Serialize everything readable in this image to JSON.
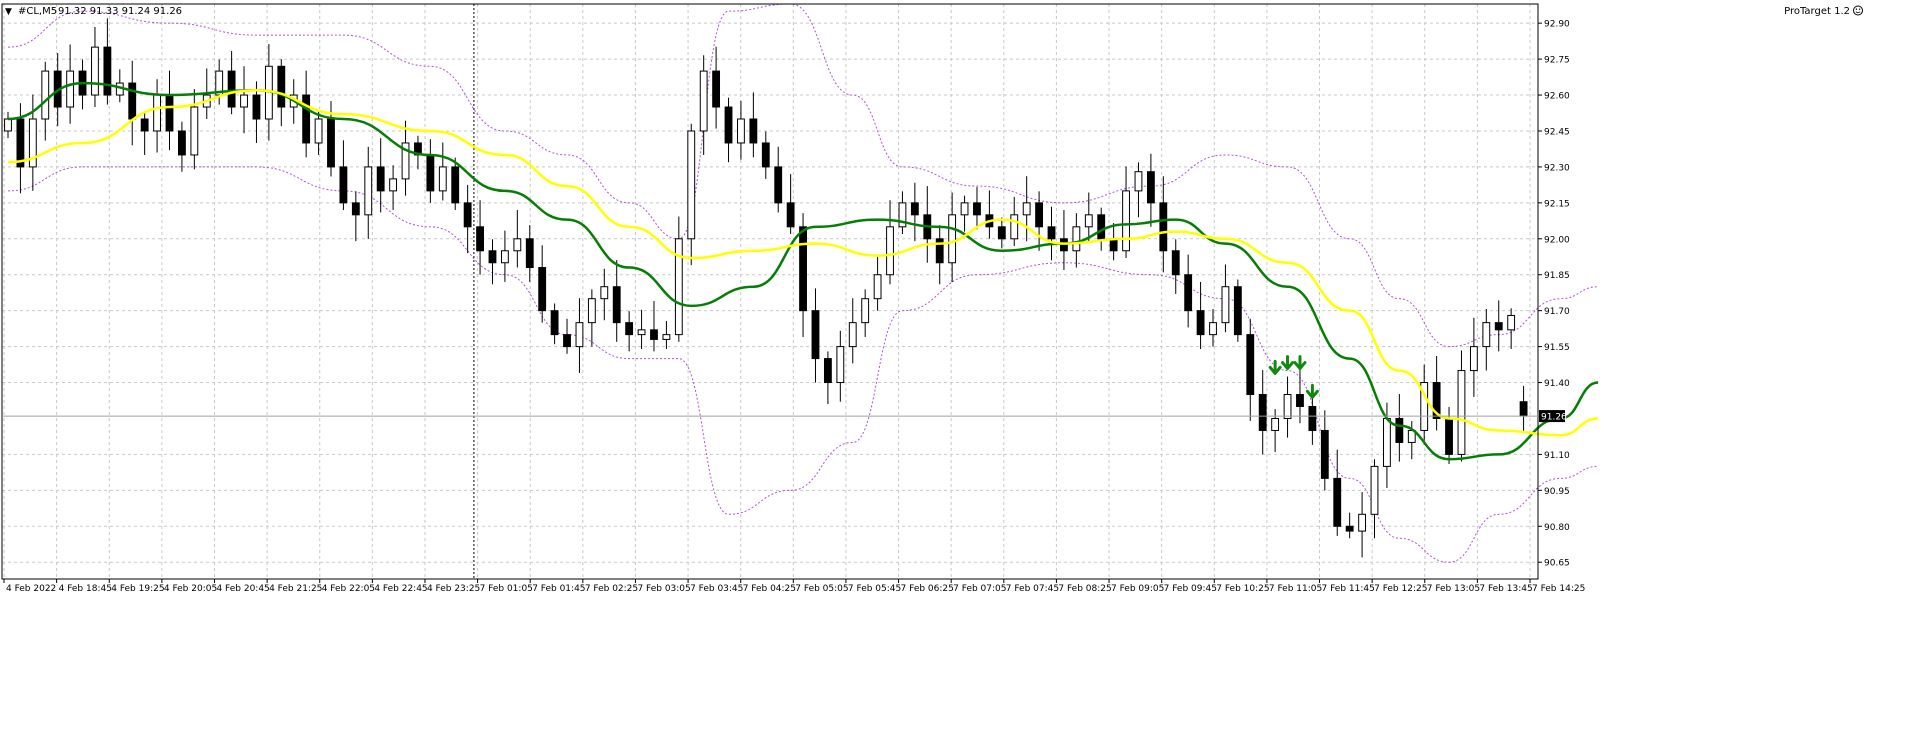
{
  "header": {
    "menu_glyph": "▼",
    "symbol": "#CL,M5",
    "ohlc": "91.32 91.33 91.24 91.26"
  },
  "indicator": {
    "name": "ProTarget 1.2",
    "icon": "smiley-icon"
  },
  "current_price_label": "91.26",
  "colors": {
    "background": "#ffffff",
    "grid": "#c8c8c8",
    "bull_body": "#ffffff",
    "bear_body": "#000000",
    "candle_outline": "#000000",
    "ma_fast": "#067d06",
    "ma_slow": "#ffff00",
    "bands": "#b050e0",
    "signal_arrow": "#0f8a0f",
    "price_tag_bg": "#000000",
    "price_tag_text": "#ffffff"
  },
  "chart_data": {
    "type": "candlestick",
    "symbol": "#CL",
    "timeframe": "M5",
    "ylim": [
      90.58,
      92.98
    ],
    "y_ticks": [
      "92.90",
      "92.75",
      "92.60",
      "92.45",
      "92.30",
      "92.15",
      "92.00",
      "91.85",
      "91.70",
      "91.55",
      "91.40",
      "91.26",
      "91.10",
      "90.95",
      "90.80",
      "90.65"
    ],
    "x_ticks": [
      "4 Feb 2022",
      "4 Feb 18:45",
      "4 Feb 19:25",
      "4 Feb 20:05",
      "4 Feb 20:45",
      "4 Feb 21:25",
      "4 Feb 22:05",
      "4 Feb 22:45",
      "4 Feb 23:25",
      "7 Feb 01:05",
      "7 Feb 01:45",
      "7 Feb 02:25",
      "7 Feb 03:05",
      "7 Feb 03:45",
      "7 Feb 04:25",
      "7 Feb 05:05",
      "7 Feb 05:45",
      "7 Feb 06:25",
      "7 Feb 07:05",
      "7 Feb 07:45",
      "7 Feb 08:25",
      "7 Feb 09:05",
      "7 Feb 09:45",
      "7 Feb 10:25",
      "7 Feb 11:05",
      "7 Feb 11:45",
      "7 Feb 12:25",
      "7 Feb 13:05",
      "7 Feb 13:45",
      "7 Feb 14:25"
    ],
    "session_break_after_label": "4 Feb 23:25",
    "last": {
      "open": 91.32,
      "high": 91.33,
      "low": 91.24,
      "close": 91.26
    },
    "path": [
      92.45,
      92.5,
      92.3,
      92.5,
      92.7,
      92.55,
      92.7,
      92.6,
      92.8,
      92.6,
      92.65,
      92.5,
      92.45,
      92.6,
      92.45,
      92.35,
      92.55,
      92.6,
      92.7,
      92.55,
      92.6,
      92.5,
      92.72,
      92.55,
      92.6,
      92.4,
      92.5,
      92.3,
      92.15,
      92.1,
      92.3,
      92.2,
      92.25,
      92.4,
      92.35,
      92.2,
      92.3,
      92.15,
      92.05,
      91.95,
      91.9,
      91.95,
      92.0,
      91.88,
      91.7,
      91.6,
      91.55,
      91.65,
      91.75,
      91.8,
      91.65,
      91.6,
      91.62,
      91.58,
      91.6,
      92.0,
      92.45,
      92.7,
      92.55,
      92.4,
      92.5,
      92.4,
      92.3,
      92.15,
      92.05,
      91.7,
      91.5,
      91.4,
      91.55,
      91.65,
      91.75,
      91.85,
      92.05,
      92.15,
      92.1,
      92.0,
      91.9,
      92.1,
      92.15,
      92.1,
      92.05,
      92.0,
      92.1,
      92.15,
      92.05,
      92.0,
      91.95,
      92.05,
      92.1,
      92.0,
      91.95,
      92.2,
      92.28,
      92.15,
      91.95,
      91.85,
      91.7,
      91.6,
      91.65,
      91.8,
      91.6,
      91.35,
      91.2,
      91.25,
      91.35,
      91.3,
      91.2,
      91.0,
      90.8,
      90.78,
      90.85,
      91.05,
      91.25,
      91.15,
      91.2,
      91.4,
      91.25,
      91.1,
      91.45,
      91.55,
      91.65,
      91.62,
      91.68
    ],
    "series": [
      {
        "style": "candles"
      },
      {
        "style": "line",
        "role": "fast moving average",
        "points": [
          [
            0,
            92.5
          ],
          [
            6,
            92.65
          ],
          [
            13,
            92.6
          ],
          [
            20,
            92.62
          ],
          [
            27,
            92.5
          ],
          [
            34,
            92.35
          ],
          [
            40,
            92.2
          ],
          [
            45,
            92.08
          ],
          [
            50,
            91.88
          ],
          [
            55,
            91.72
          ],
          [
            60,
            91.8
          ],
          [
            65,
            92.05
          ],
          [
            70,
            92.08
          ],
          [
            75,
            92.05
          ],
          [
            80,
            91.95
          ],
          [
            85,
            91.98
          ],
          [
            90,
            92.06
          ],
          [
            94,
            92.08
          ],
          [
            98,
            91.98
          ],
          [
            103,
            91.8
          ],
          [
            108,
            91.5
          ],
          [
            112,
            91.22
          ],
          [
            116,
            91.08
          ],
          [
            120,
            91.1
          ],
          [
            125,
            91.25
          ],
          [
            128,
            91.4
          ]
        ]
      },
      {
        "style": "line",
        "role": "slow moving average",
        "points": [
          [
            0,
            92.32
          ],
          [
            6,
            92.4
          ],
          [
            13,
            92.55
          ],
          [
            20,
            92.62
          ],
          [
            27,
            92.52
          ],
          [
            34,
            92.45
          ],
          [
            40,
            92.35
          ],
          [
            45,
            92.22
          ],
          [
            50,
            92.05
          ],
          [
            55,
            91.92
          ],
          [
            60,
            91.95
          ],
          [
            65,
            91.98
          ],
          [
            70,
            91.93
          ],
          [
            75,
            91.98
          ],
          [
            80,
            92.08
          ],
          [
            85,
            91.98
          ],
          [
            90,
            92.0
          ],
          [
            94,
            92.03
          ],
          [
            98,
            92.0
          ],
          [
            103,
            91.9
          ],
          [
            108,
            91.7
          ],
          [
            112,
            91.45
          ],
          [
            116,
            91.25
          ],
          [
            120,
            91.2
          ],
          [
            125,
            91.18
          ],
          [
            128,
            91.25
          ]
        ]
      },
      {
        "style": "dotted",
        "role": "upper band",
        "points": [
          [
            0,
            92.8
          ],
          [
            6,
            92.95
          ],
          [
            13,
            92.9
          ],
          [
            20,
            92.85
          ],
          [
            27,
            92.85
          ],
          [
            34,
            92.72
          ],
          [
            40,
            92.45
          ],
          [
            45,
            92.35
          ],
          [
            50,
            92.15
          ],
          [
            54,
            92.0
          ],
          [
            58,
            92.95
          ],
          [
            63,
            92.98
          ],
          [
            68,
            92.6
          ],
          [
            72,
            92.3
          ],
          [
            78,
            92.22
          ],
          [
            85,
            92.15
          ],
          [
            92,
            92.22
          ],
          [
            98,
            92.35
          ],
          [
            103,
            92.3
          ],
          [
            108,
            92.0
          ],
          [
            112,
            91.75
          ],
          [
            116,
            91.55
          ],
          [
            120,
            91.6
          ],
          [
            125,
            91.75
          ],
          [
            128,
            91.8
          ]
        ]
      },
      {
        "style": "dotted",
        "role": "lower band",
        "points": [
          [
            0,
            92.2
          ],
          [
            6,
            92.3
          ],
          [
            13,
            92.3
          ],
          [
            20,
            92.3
          ],
          [
            27,
            92.2
          ],
          [
            34,
            92.05
          ],
          [
            40,
            91.85
          ],
          [
            45,
            91.6
          ],
          [
            50,
            91.5
          ],
          [
            54,
            91.5
          ],
          [
            58,
            90.85
          ],
          [
            63,
            90.95
          ],
          [
            68,
            91.15
          ],
          [
            72,
            91.7
          ],
          [
            78,
            91.85
          ],
          [
            85,
            91.9
          ],
          [
            92,
            91.85
          ],
          [
            98,
            91.75
          ],
          [
            103,
            91.45
          ],
          [
            108,
            91.0
          ],
          [
            112,
            90.75
          ],
          [
            116,
            90.65
          ],
          [
            120,
            90.85
          ],
          [
            125,
            91.0
          ],
          [
            128,
            91.05
          ]
        ]
      }
    ],
    "signals": [
      {
        "bar": 102,
        "price": 91.43,
        "type": "sell"
      },
      {
        "bar": 103,
        "price": 91.45,
        "type": "sell"
      },
      {
        "bar": 104,
        "price": 91.45,
        "type": "sell"
      },
      {
        "bar": 105,
        "price": 91.33,
        "type": "sell"
      }
    ],
    "grid": true,
    "axis_side": "right"
  }
}
